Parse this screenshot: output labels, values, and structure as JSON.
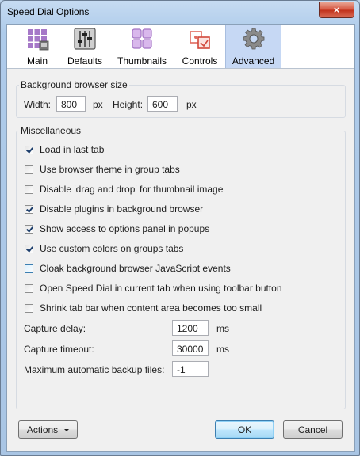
{
  "window": {
    "title": "Speed Dial Options",
    "close_glyph": "×"
  },
  "tabs": [
    {
      "label": "Main",
      "icon": "main-grid-icon"
    },
    {
      "label": "Defaults",
      "icon": "defaults-sliders-icon"
    },
    {
      "label": "Thumbnails",
      "icon": "thumbnails-icon"
    },
    {
      "label": "Controls",
      "icon": "controls-icon"
    },
    {
      "label": "Advanced",
      "icon": "gear-icon",
      "active": true
    }
  ],
  "browser_size": {
    "legend": "Background browser size",
    "width_label": "Width:",
    "width_value": "800",
    "width_unit": "px",
    "height_label": "Height:",
    "height_value": "600",
    "height_unit": "px"
  },
  "misc": {
    "legend": "Miscellaneous",
    "options": [
      {
        "label": "Load in last tab",
        "checked": true
      },
      {
        "label": "Use browser theme in group tabs",
        "checked": false
      },
      {
        "label": "Disable 'drag and drop' for thumbnail image",
        "checked": false
      },
      {
        "label": "Disable plugins in background browser",
        "checked": true
      },
      {
        "label": "Show access to options panel in popups",
        "checked": true
      },
      {
        "label": "Use custom colors on groups tabs",
        "checked": true
      },
      {
        "label": "Cloak background browser JavaScript events",
        "checked": false,
        "hover": true
      },
      {
        "label": "Open Speed Dial in current tab when using toolbar button",
        "checked": false
      },
      {
        "label": "Shrink tab bar when content area becomes too small",
        "checked": false
      }
    ],
    "capture_delay_label": "Capture delay:",
    "capture_delay_value": "1200",
    "capture_delay_unit": "ms",
    "capture_timeout_label": "Capture timeout:",
    "capture_timeout_value": "30000",
    "capture_timeout_unit": "ms",
    "backup_label": "Maximum automatic backup files:",
    "backup_value": "-1"
  },
  "buttons": {
    "actions": "Actions",
    "ok": "OK",
    "cancel": "Cancel"
  },
  "colors": {
    "titlebar": "#bcd3ec",
    "active_tab": "#c6d8f4",
    "client": "#f0f0f0"
  }
}
